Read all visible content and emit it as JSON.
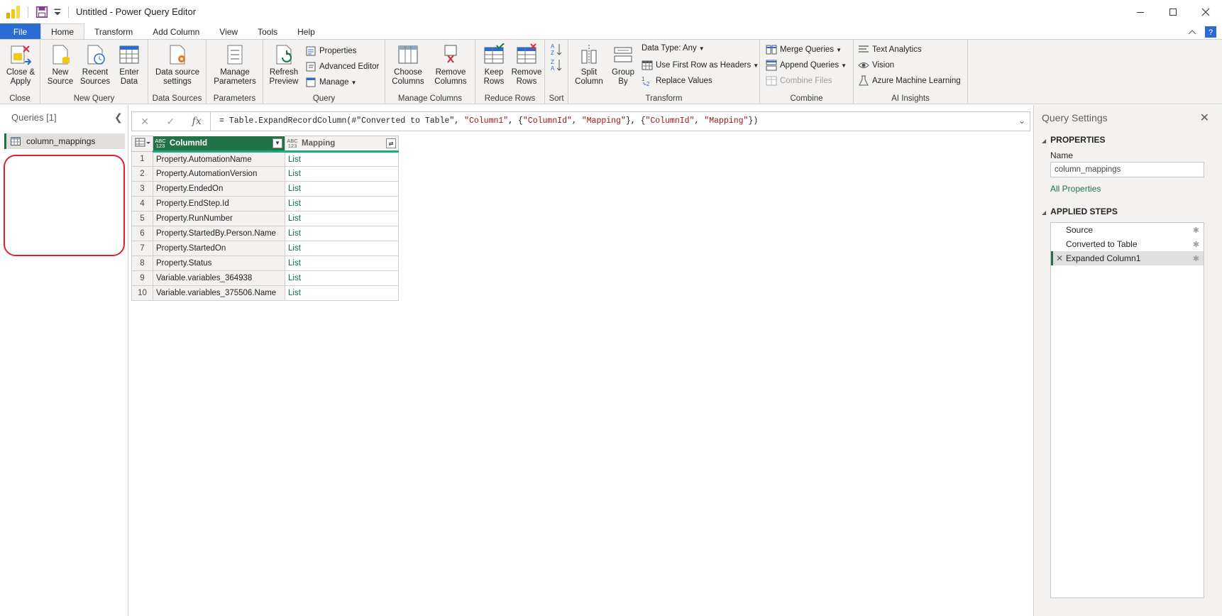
{
  "window": {
    "title": "Untitled - Power Query Editor"
  },
  "tabs": [
    "File",
    "Home",
    "Transform",
    "Add Column",
    "View",
    "Tools",
    "Help"
  ],
  "ribbon": {
    "close_apply": "Close &\nApply",
    "group_close": "Close",
    "new_source": "New\nSource",
    "recent_sources": "Recent\nSources",
    "enter_data": "Enter\nData",
    "group_new_query": "New Query",
    "data_source_settings": "Data source\nsettings",
    "group_data_sources": "Data Sources",
    "manage_parameters": "Manage\nParameters",
    "group_parameters": "Parameters",
    "refresh_preview": "Refresh\nPreview",
    "properties": "Properties",
    "advanced_editor": "Advanced Editor",
    "manage": "Manage",
    "group_query": "Query",
    "choose_columns": "Choose\nColumns",
    "remove_columns": "Remove\nColumns",
    "group_manage_columns": "Manage Columns",
    "keep_rows": "Keep\nRows",
    "remove_rows": "Remove\nRows",
    "group_reduce_rows": "Reduce Rows",
    "group_sort": "Sort",
    "split_column": "Split\nColumn",
    "group_by": "Group\nBy",
    "data_type": "Data Type: Any",
    "use_first_row": "Use First Row as Headers",
    "replace_values": "Replace Values",
    "group_transform": "Transform",
    "merge_queries": "Merge Queries",
    "append_queries": "Append Queries",
    "combine_files": "Combine Files",
    "group_combine": "Combine",
    "text_analytics": "Text Analytics",
    "vision": "Vision",
    "azure_ml": "Azure Machine Learning",
    "group_ai": "AI Insights"
  },
  "queries_pane": {
    "header": "Queries [1]",
    "items": [
      "column_mappings"
    ]
  },
  "formula_bar": {
    "fx": "fx",
    "prefix": "= Table.ExpandRecordColumn(#\"Converted to Table\", ",
    "s1": "\"Column1\"",
    "mid1": ", {",
    "s2": "\"ColumnId\"",
    "mid2": ", ",
    "s3": "\"Mapping\"",
    "mid3": "}, {",
    "s4": "\"ColumnId\"",
    "mid4": ", ",
    "s5": "\"Mapping\"",
    "suffix": "})"
  },
  "grid": {
    "type_badge": "ABC\n123",
    "columns": [
      "ColumnId",
      "Mapping"
    ],
    "rows": [
      {
        "n": "1",
        "id": "Property.AutomationName",
        "m": "List"
      },
      {
        "n": "2",
        "id": "Property.AutomationVersion",
        "m": "List"
      },
      {
        "n": "3",
        "id": "Property.EndedOn",
        "m": "List"
      },
      {
        "n": "4",
        "id": "Property.EndStep.Id",
        "m": "List"
      },
      {
        "n": "5",
        "id": "Property.RunNumber",
        "m": "List"
      },
      {
        "n": "6",
        "id": "Property.StartedBy.Person.Name",
        "m": "List"
      },
      {
        "n": "7",
        "id": "Property.StartedOn",
        "m": "List"
      },
      {
        "n": "8",
        "id": "Property.Status",
        "m": "List"
      },
      {
        "n": "9",
        "id": "Variable.variables_364938",
        "m": "List"
      },
      {
        "n": "10",
        "id": "Variable.variables_375506.Name",
        "m": "List"
      }
    ]
  },
  "settings": {
    "title": "Query Settings",
    "properties_header": "PROPERTIES",
    "name_label": "Name",
    "name_value": "column_mappings",
    "all_properties": "All Properties",
    "applied_steps_header": "APPLIED STEPS",
    "steps": [
      "Source",
      "Converted to Table",
      "Expanded Column1"
    ],
    "active_step": 2
  },
  "colors": {
    "accent_green": "#217346",
    "file_tab_blue": "#2b6cd4",
    "annotation_red": "#e0202e"
  }
}
